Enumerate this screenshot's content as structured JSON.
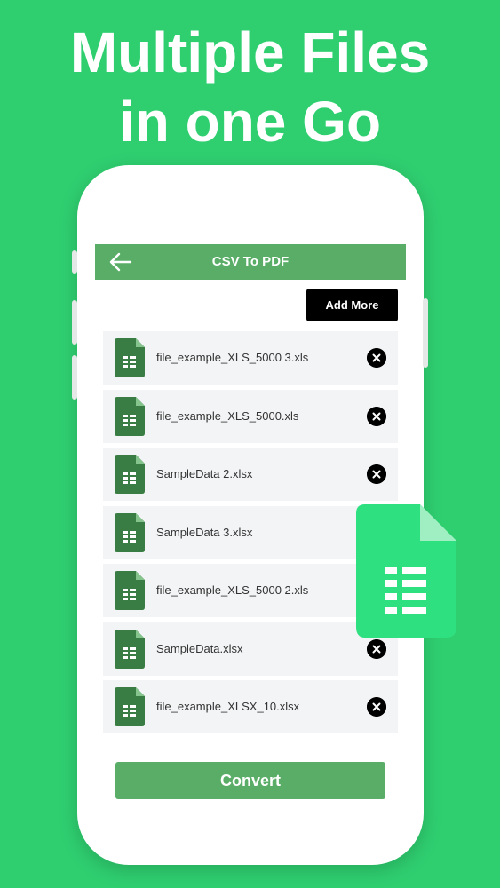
{
  "promo": {
    "headline_line1": "Multiple Files",
    "headline_line2": "in one Go"
  },
  "app_bar": {
    "back_icon": "arrow-left-icon",
    "title": "CSV To PDF"
  },
  "add_more_label": "Add More",
  "files": [
    {
      "name": "file_example_XLS_5000 3.xls",
      "remove_visible": true
    },
    {
      "name": "file_example_XLS_5000.xls",
      "remove_visible": true
    },
    {
      "name": "SampleData 2.xlsx",
      "remove_visible": true
    },
    {
      "name": "SampleData 3.xlsx",
      "remove_visible": false
    },
    {
      "name": "file_example_XLS_5000 2.xls",
      "remove_visible": false
    },
    {
      "name": "SampleData.xlsx",
      "remove_visible": true
    },
    {
      "name": "file_example_XLSX_10.xlsx",
      "remove_visible": true
    }
  ],
  "convert_label": "Convert",
  "colors": {
    "background": "#2fcf70",
    "app_bar": "#59ad67",
    "file_icon": "#3a7d44",
    "big_icon": "#2ee080"
  },
  "icons": {
    "file": "spreadsheet-file-icon",
    "remove": "close-circle-icon",
    "decor": "spreadsheet-file-icon"
  }
}
